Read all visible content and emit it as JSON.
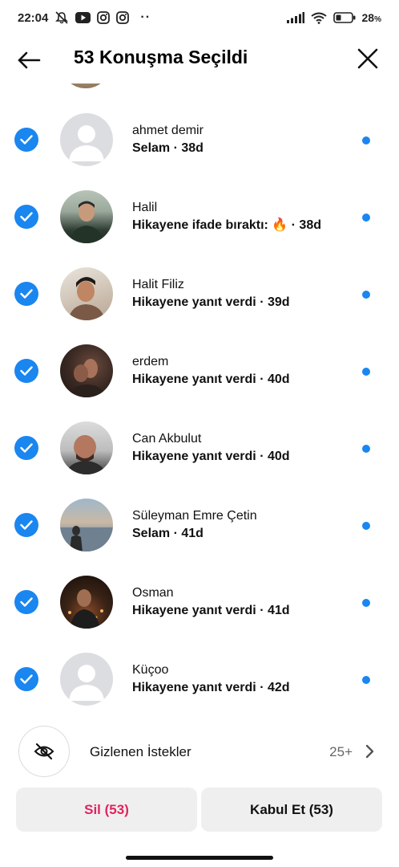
{
  "status_bar": {
    "time": "22:04",
    "battery": "28",
    "battery_unit": "%",
    "more": "··",
    "icons": [
      "mute-icon",
      "youtube-icon",
      "instagram-icon",
      "instagram-icon",
      "signal-icon",
      "wifi-icon",
      "battery-icon"
    ]
  },
  "header": {
    "title": "53 Konuşma Seçildi",
    "back_icon": "arrow-left-icon",
    "close_icon": "close-icon"
  },
  "conversations": [
    {
      "name": "ahmet demir",
      "message": "Selam · 38d",
      "avatar": "placeholder",
      "selected": true,
      "unread": true
    },
    {
      "name": "Halil",
      "message": "Hikayene ifade bıraktı: 🔥 · 38d",
      "avatar": "photo",
      "selected": true,
      "unread": true
    },
    {
      "name": "Halit Filiz",
      "message": "Hikayene yanıt verdi · 39d",
      "avatar": "photo",
      "selected": true,
      "unread": true
    },
    {
      "name": "erdem",
      "message": "Hikayene yanıt verdi · 40d",
      "avatar": "photo",
      "selected": true,
      "unread": true
    },
    {
      "name": "Can Akbulut",
      "message": "Hikayene yanıt verdi · 40d",
      "avatar": "photo",
      "selected": true,
      "unread": true
    },
    {
      "name": "Süleyman Emre Çetin",
      "message": "Selam · 41d",
      "avatar": "photo",
      "selected": true,
      "unread": true
    },
    {
      "name": "Osman",
      "message": "Hikayene yanıt verdi · 41d",
      "avatar": "photo",
      "selected": true,
      "unread": true
    },
    {
      "name": "Küçoo",
      "message": "Hikayene yanıt verdi · 42d",
      "avatar": "placeholder",
      "selected": true,
      "unread": true
    }
  ],
  "hidden_requests": {
    "label": "Gizlenen İstekler",
    "count": "25+",
    "icon": "eye-off-icon"
  },
  "actions": {
    "delete_label": "Sil (53)",
    "accept_label": "Kabul Et (53)"
  },
  "colors": {
    "accent": "#1a86f0",
    "delete": "#e0245e",
    "button_bg": "#efefef"
  }
}
